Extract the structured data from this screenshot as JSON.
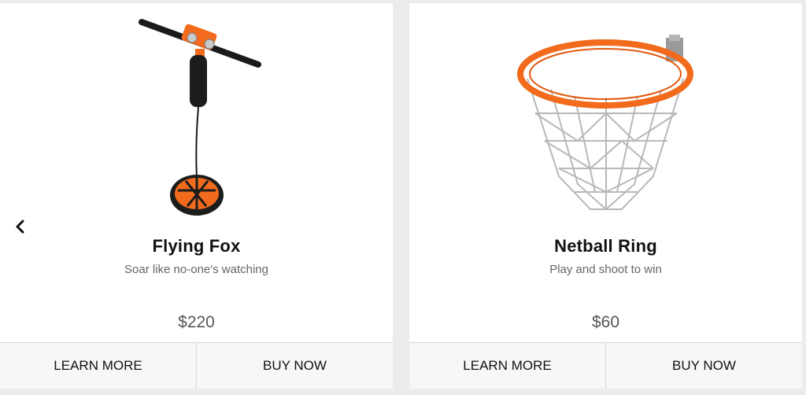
{
  "carousel": {
    "prev_icon": "chevron-left-icon",
    "products": [
      {
        "name": "Flying Fox",
        "tagline": "Soar like no-one's watching",
        "price": "$220",
        "learn_more_label": "LEARN MORE",
        "buy_now_label": "BUY NOW",
        "accent_color": "#f26b1d"
      },
      {
        "name": "Netball Ring",
        "tagline": "Play and shoot to win",
        "price": "$60",
        "learn_more_label": "LEARN MORE",
        "buy_now_label": "BUY NOW",
        "accent_color": "#f26b1d"
      }
    ]
  }
}
